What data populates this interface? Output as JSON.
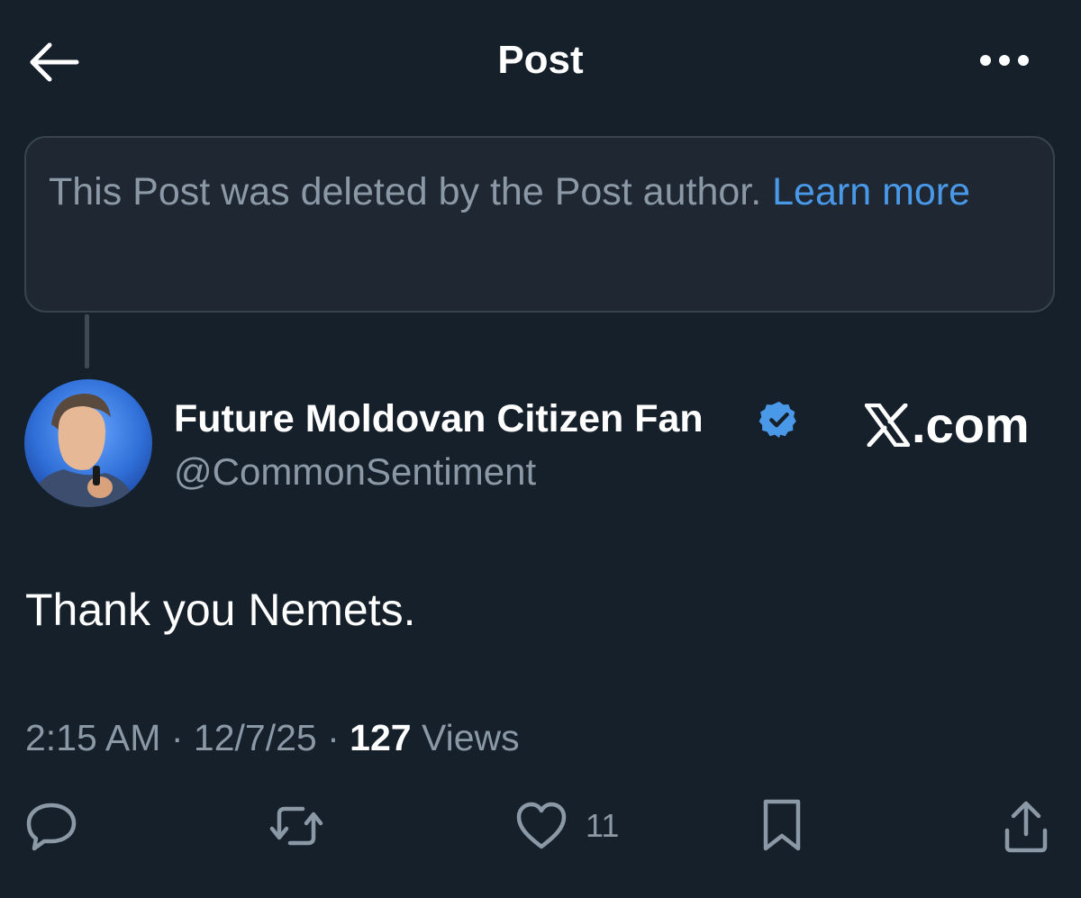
{
  "header": {
    "title": "Post",
    "back_icon": "arrow-left-icon",
    "more_icon": "more-horizontal-icon"
  },
  "deleted_notice": {
    "text": "This Post was deleted by the Post author.",
    "link": "Learn more"
  },
  "author": {
    "display_name": "Future Moldovan Citizen Fan",
    "handle": "@CommonSentiment",
    "verified": true,
    "verified_color": "#4a99e9"
  },
  "watermark": {
    "text": ".com",
    "logo_icon": "x-logo-icon"
  },
  "post": {
    "text": "Thank you Nemets."
  },
  "meta": {
    "time": "2:15 AM",
    "separator": "·",
    "date": "12/7/25",
    "views_count": "127",
    "views_label": "Views"
  },
  "actions": {
    "reply_icon": "reply-icon",
    "repost_icon": "repost-icon",
    "like_icon": "heart-icon",
    "like_count": "11",
    "bookmark_icon": "bookmark-icon",
    "share_icon": "share-icon"
  },
  "colors": {
    "background": "#15202b",
    "link": "#4a99e9",
    "secondary_text": "#8b98a5"
  }
}
